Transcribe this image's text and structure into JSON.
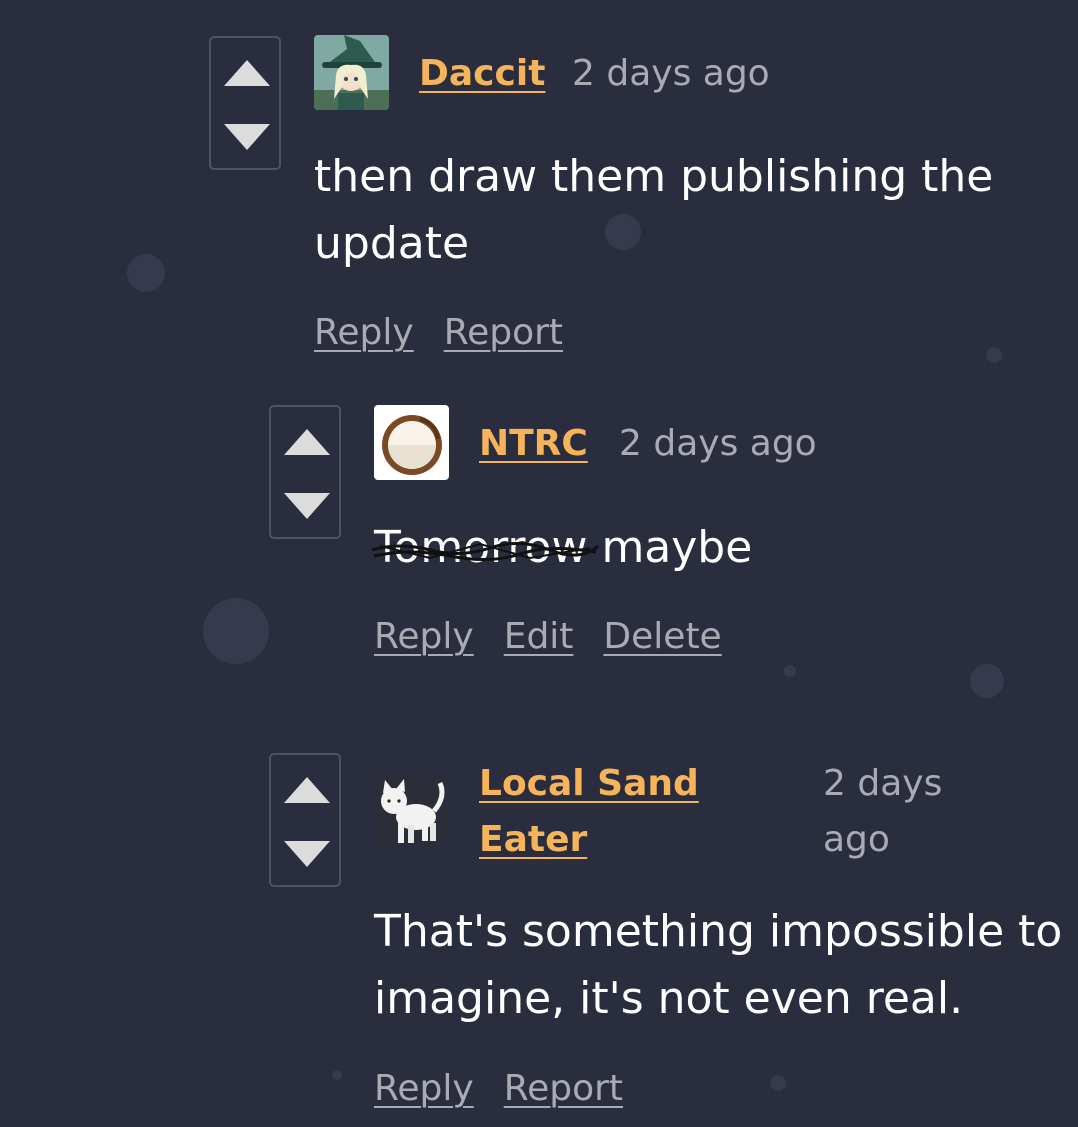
{
  "comments": [
    {
      "author": "Daccit",
      "time": "2 days ago",
      "body": "then draw them publishing the update",
      "actions": [
        "Reply",
        "Report"
      ],
      "avatar": "witch-avatar"
    },
    {
      "author": "NTRC",
      "time": "2 days ago",
      "body_struck": "Tomorrow",
      "body_rest": " maybe",
      "actions": [
        "Reply",
        "Edit",
        "Delete"
      ],
      "avatar": "coconut-avatar"
    },
    {
      "author": "Local Sand Eater",
      "time": "2 days ago",
      "body": "That's something impossible to imagine, it's not even real.",
      "actions": [
        "Reply",
        "Report"
      ],
      "avatar": "cat-avatar"
    }
  ],
  "colors": {
    "background": "#2a2d3e",
    "author": "#f5b45a",
    "muted": "#a9abb4",
    "text": "#ffffff"
  }
}
